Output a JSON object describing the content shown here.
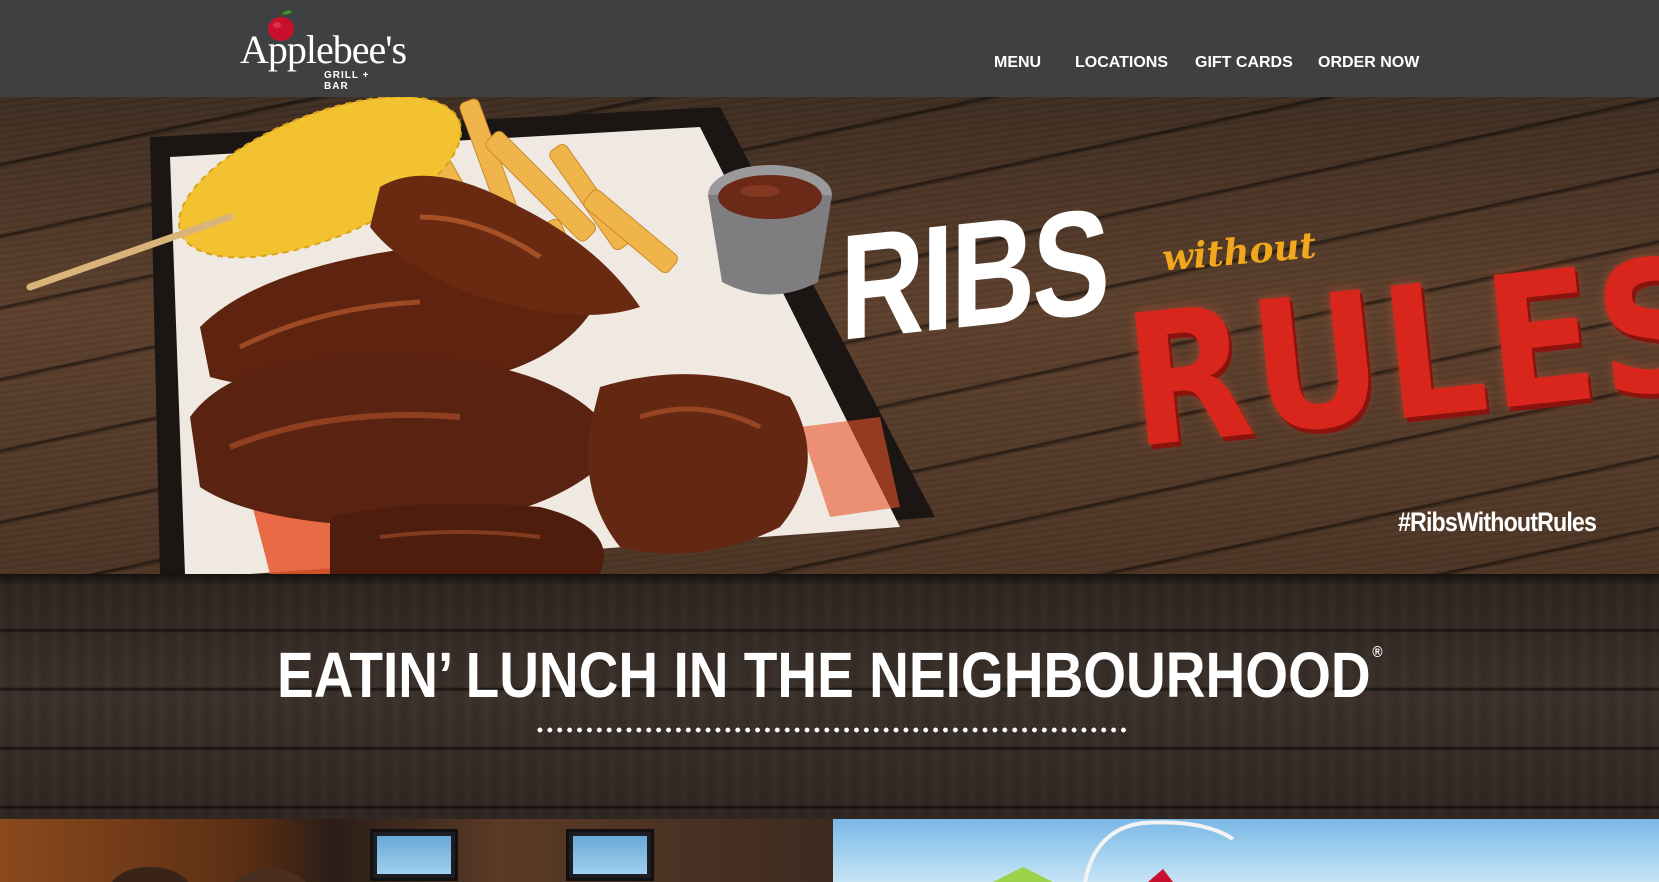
{
  "header": {
    "logo": {
      "name": "Applebee's",
      "tagline": "GRILL + BAR"
    },
    "nav": [
      {
        "label": "MENU"
      },
      {
        "label": "LOCATIONS"
      },
      {
        "label": "GIFT CARDS"
      },
      {
        "label": "ORDER NOW"
      }
    ]
  },
  "hero": {
    "headline_ribs": "RIBS",
    "headline_without": "without",
    "headline_rules": "RULES",
    "hashtag": "#RibsWithoutRules"
  },
  "band": {
    "headline": "EATIN’ LUNCH IN THE NEIGHBOURHOOD",
    "registered_mark": "®"
  },
  "tiles": [
    {
      "name": "restaurant-interior-tile"
    },
    {
      "name": "drink-tile"
    }
  ],
  "colors": {
    "header_bg": "#3f4042",
    "rules_red": "#d9261c",
    "without_orange": "#f2a81c",
    "text_white": "#ffffff"
  }
}
